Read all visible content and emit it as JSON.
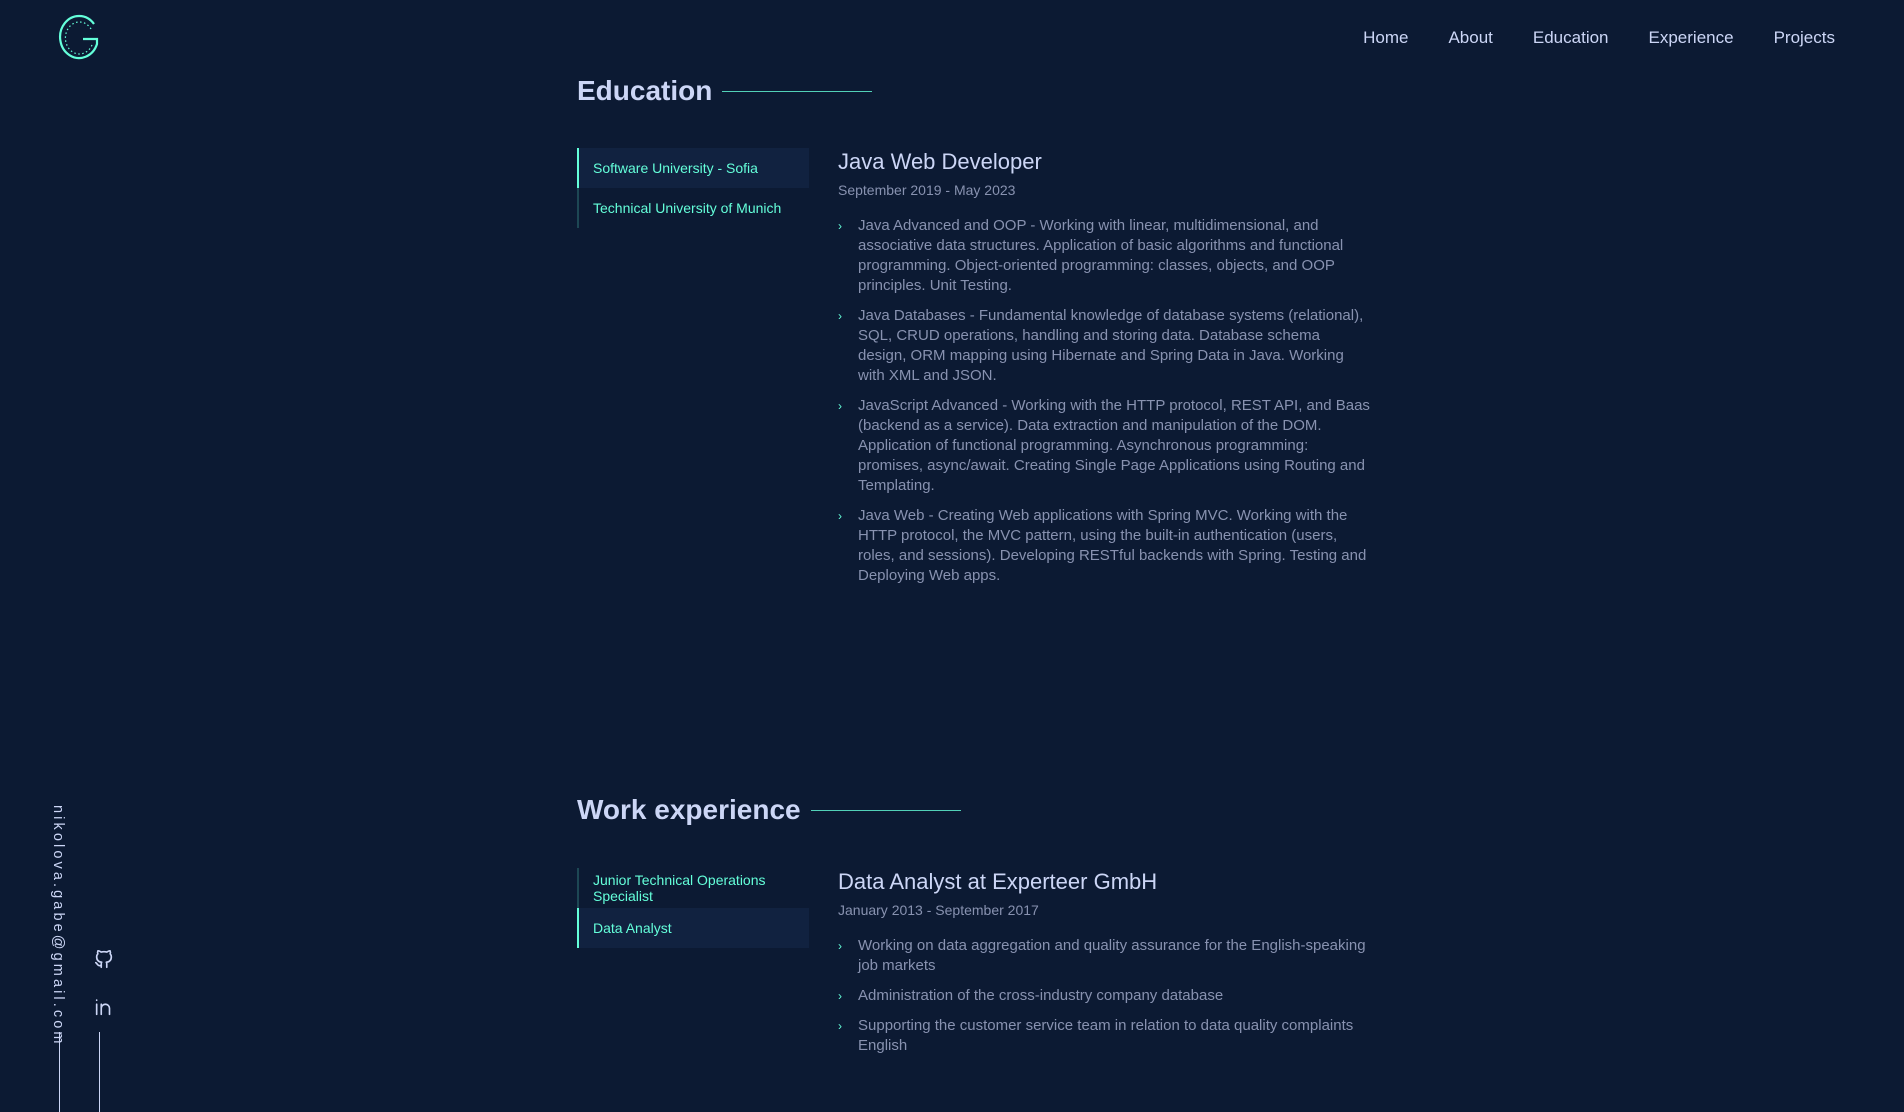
{
  "nav": {
    "items": [
      "Home",
      "About",
      "Education",
      "Experience",
      "Projects"
    ]
  },
  "brand": {
    "logo_icon": "g-logo-icon",
    "accent": "#64ffda",
    "background": "#0c1a33"
  },
  "social": {
    "email": "nikolova.gabe@gmail.com",
    "icons": [
      "github-icon",
      "linkedin-icon"
    ]
  },
  "education": {
    "title": "Education",
    "tabs": [
      "Software University - Sofia",
      "Technical University of Munich"
    ],
    "active_tab": 0,
    "panel": {
      "role": "Java Web Developer",
      "dates": "September 2019 - May 2023",
      "bullets": [
        "Java Advanced and OOP - Working with linear, multidimensional, and associative data structures. Application of basic algorithms and functional programming. Object-oriented programming: classes, objects, and OOP principles. Unit Testing.",
        "Java Databases - Fundamental knowledge of database systems (relational), SQL, CRUD operations, handling and storing data. Database schema design, ORM mapping using Hibernate and Spring Data in Java. Working with XML and JSON.",
        "JavaScript Advanced - Working with the HTTP protocol, REST API, and Baas (backend as a service). Data extraction and manipulation of the DOM. Application of functional programming. Asynchronous programming: promises, async/await. Creating Single Page Applications using Routing and Templating.",
        "Java Web - Creating Web applications with Spring MVC. Working with the HTTP protocol, the MVC pattern, using the built-in authentication (users, roles, and sessions). Developing RESTful backends with Spring. Testing and Deploying Web apps."
      ]
    }
  },
  "work": {
    "title": "Work experience",
    "tabs": [
      "Junior Technical Operations Specialist",
      "Data Analyst"
    ],
    "active_tab": 1,
    "panel": {
      "role": "Data Analyst at Experteer GmbH",
      "dates": "January 2013 - September 2017",
      "bullets": [
        "Working on data aggregation and quality assurance for the English-speaking job markets",
        "Administration of the cross-industry company database",
        "Supporting the customer service team in relation to data quality complaints English"
      ]
    }
  }
}
